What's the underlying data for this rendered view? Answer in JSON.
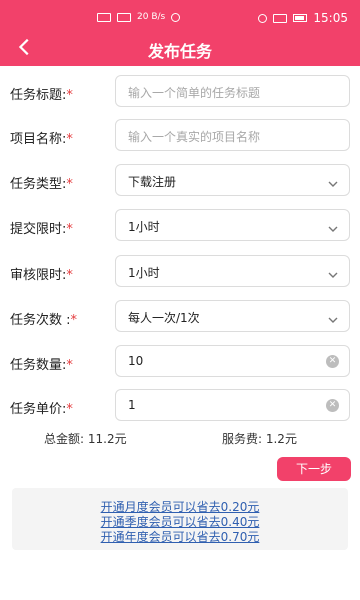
{
  "status_bar": {
    "time": "15:05",
    "speed": "20 B/s"
  },
  "header": {
    "title": "发布任务",
    "back_icon": "chevron-left-icon"
  },
  "form": {
    "rows": [
      {
        "label": "任务标题:",
        "required": "*",
        "placeholder": "输入一个简单的任务标题"
      },
      {
        "label": "项目名称:",
        "required": "*",
        "placeholder": "输入一个真实的项目名称"
      },
      {
        "label": "任务类型:",
        "required": "*",
        "value": "下载注册"
      },
      {
        "label": "提交限时:",
        "required": "*",
        "value": "1小时"
      },
      {
        "label": "审核限时:",
        "required": "*",
        "value": "1小时"
      },
      {
        "label": "任务次数 :",
        "required": "*",
        "value": "每人一次/1次"
      },
      {
        "label": "任务数量:",
        "required": "*",
        "value": "10"
      },
      {
        "label": "任务单价:",
        "required": "*",
        "value": "1"
      }
    ]
  },
  "summary": {
    "total": "总金额:  11.2元",
    "fee": "服务费:  1.2元"
  },
  "actions": {
    "next_label": "下一步"
  },
  "promo": {
    "lines": [
      "开通月度会员可以省去0.20元",
      "开通季度会员可以省去0.40元",
      "开通年度会员可以省去0.70元"
    ]
  },
  "colors": {
    "accent": "#f2416a",
    "link": "#2f5fb0"
  }
}
